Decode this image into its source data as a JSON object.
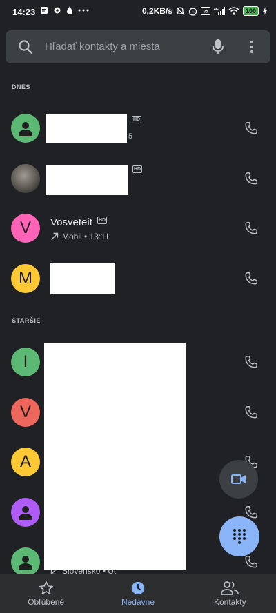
{
  "status_bar": {
    "time": "14:23",
    "net_speed": "0,2KB/s",
    "battery": "100",
    "icons": [
      "message-icon",
      "settings-icon",
      "drop-icon",
      "more-dots-icon",
      "mute-icon",
      "alarm-icon",
      "volte-icon",
      "signal-icon",
      "wifi-icon",
      "battery-icon",
      "charging-icon"
    ]
  },
  "search": {
    "placeholder": "Hľadať kontakty a miesta"
  },
  "sections": {
    "today": "DNES",
    "older": "STARŠIE"
  },
  "calls_today": [
    {
      "avatar_type": "person",
      "avatar_color": "#5bb974",
      "name": "",
      "hd": "HD",
      "detail": "5"
    },
    {
      "avatar_type": "photo",
      "name": "",
      "hd": "HD",
      "detail": ""
    },
    {
      "avatar_type": "letter",
      "avatar_letter": "V",
      "avatar_color": "#ff63b8",
      "name": "Vosveteit",
      "hd": "HD",
      "detail": "Mobil • 13:11",
      "direction": "outgoing"
    },
    {
      "avatar_type": "letter",
      "avatar_letter": "M",
      "avatar_color": "#fcc934",
      "name": "",
      "detail": ""
    }
  ],
  "calls_older": [
    {
      "avatar_type": "letter",
      "avatar_letter": "I",
      "avatar_color": "#5bb974"
    },
    {
      "avatar_type": "letter",
      "avatar_letter": "V",
      "avatar_color": "#ee675c"
    },
    {
      "avatar_type": "letter",
      "avatar_letter": "A",
      "avatar_color": "#fcc934"
    },
    {
      "avatar_type": "person",
      "avatar_color": "#af5cf7"
    },
    {
      "avatar_type": "person",
      "avatar_color": "#5bb974",
      "detail": "Slovensko • Ut",
      "direction": "incoming"
    }
  ],
  "bottom_nav": {
    "favorites": "Obľúbené",
    "recents": "Nedávne",
    "contacts": "Kontakty",
    "active": "recents"
  },
  "colors": {
    "background": "#202124",
    "accent": "#8ab4f8",
    "search_bg": "#3c4043",
    "nav_bg": "#2d2e30"
  }
}
